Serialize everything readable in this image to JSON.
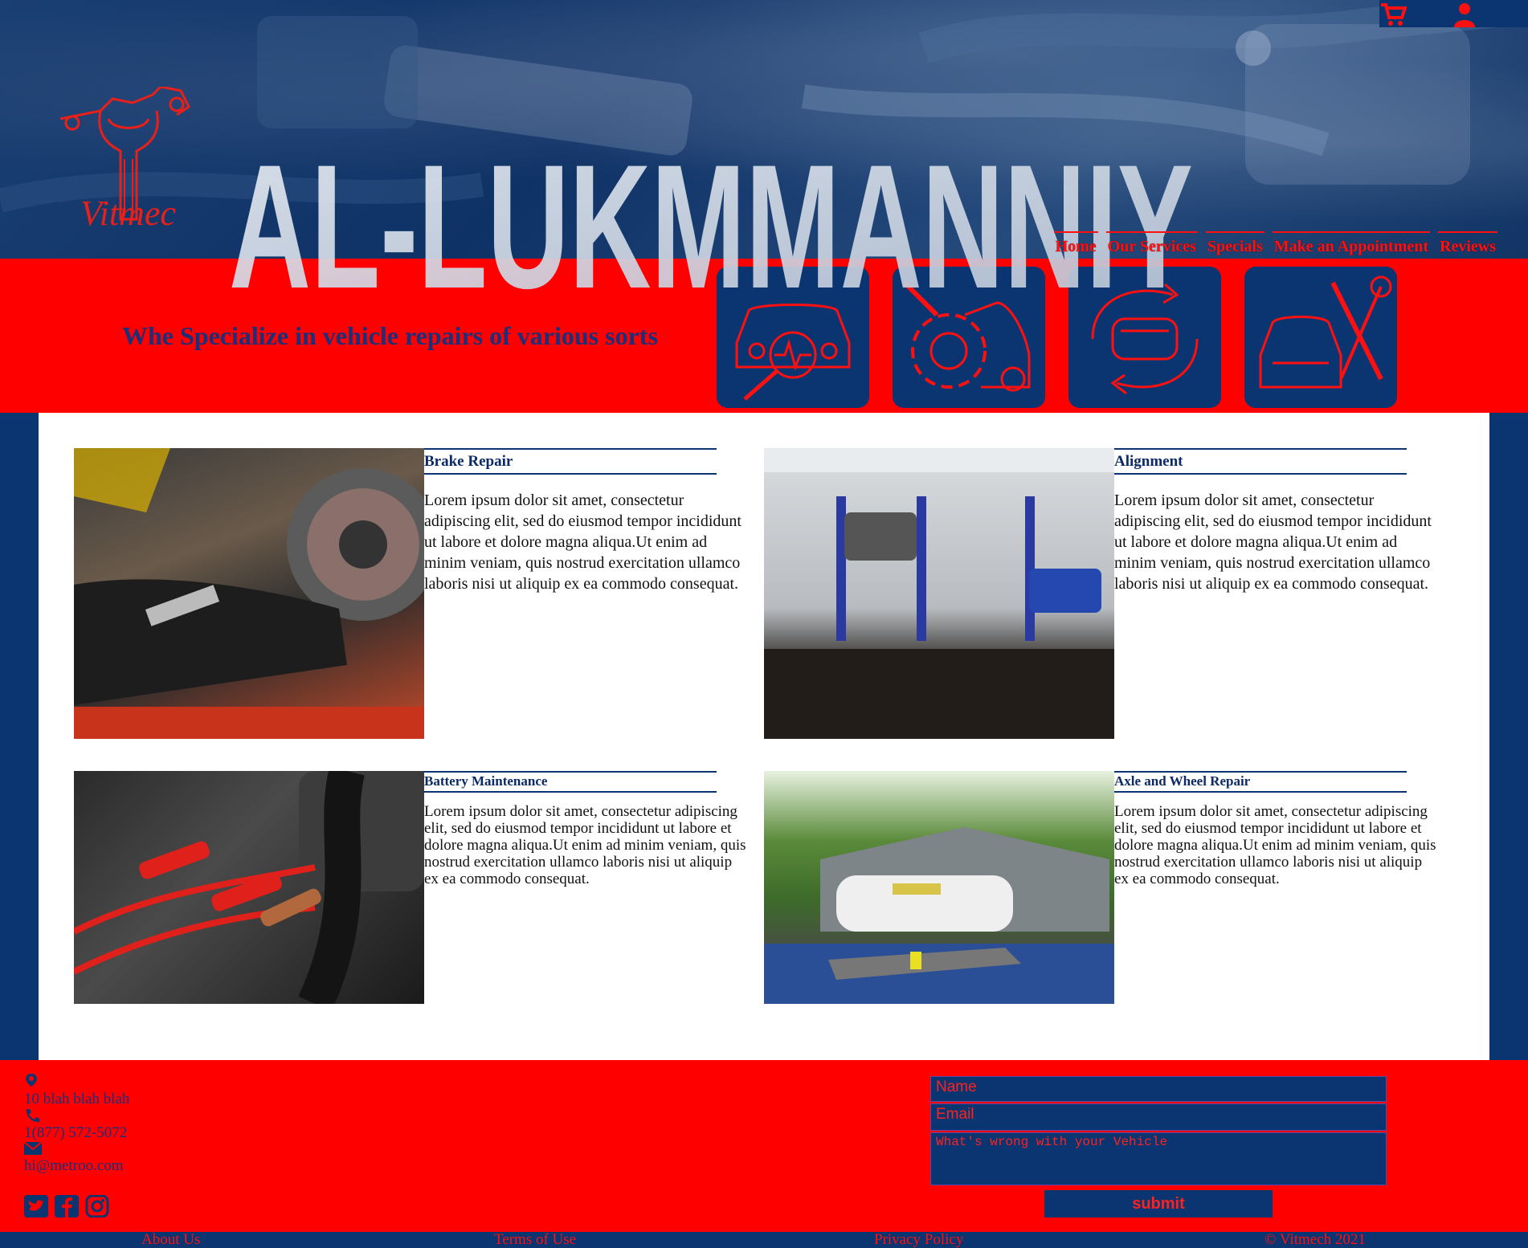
{
  "brand": {
    "logo_text": "Vitmec",
    "title": "AL-LUKMMANNIY",
    "tagline": "Whe Specialize in vehicle repairs of various sorts"
  },
  "header_icons": [
    "cart-icon",
    "user-icon"
  ],
  "nav": [
    "Home",
    "Our Services",
    "Specials",
    "Make an Appointment",
    "Reviews"
  ],
  "service_tiles": [
    "car-diagnostic-icon",
    "car-gear-service-icon",
    "car-rotation-icon",
    "car-tools-icon"
  ],
  "cards": [
    {
      "title": "Brake Repair",
      "body": "Lorem ipsum dolor sit amet, consectetur adipiscing elit, sed do eiusmod tempor incididunt ut labore et dolore magna aliqua.Ut enim ad minim veniam, quis nostrud exercitation ullamco laboris nisi ut aliquip ex ea commodo consequat."
    },
    {
      "title": "Alignment",
      "body": "Lorem ipsum dolor sit amet, consectetur adipiscing elit, sed do eiusmod tempor incididunt ut labore et dolore magna aliqua.Ut enim ad minim veniam, quis nostrud exercitation ullamco laboris nisi ut aliquip ex ea commodo consequat."
    },
    {
      "title": "Battery Maintenance",
      "body": "Lorem ipsum dolor sit amet, consectetur adipiscing elit, sed do eiusmod tempor incididunt ut labore et dolore magna aliqua.Ut enim ad minim veniam, quis nostrud exercitation ullamco laboris nisi ut aliquip ex ea commodo consequat."
    },
    {
      "title": "Axle and Wheel Repair",
      "body": "Lorem ipsum dolor sit amet, consectetur adipiscing elit, sed do eiusmod tempor incididunt ut labore et dolore magna aliqua.Ut enim ad minim veniam, quis nostrud exercitation ullamco laboris nisi ut aliquip ex ea commodo consequat."
    }
  ],
  "contact": {
    "address": "10 blah blah blah",
    "phone": "1(877) 572-5072",
    "email": "hi@metroo.com"
  },
  "social": [
    "twitter-icon",
    "facebook-icon",
    "instagram-icon"
  ],
  "form": {
    "name_placeholder": "Name",
    "email_placeholder": "Email",
    "message_placeholder": "What's wrong with your Vehicle",
    "submit_label": "submit"
  },
  "footer_links": [
    "About Us",
    "Terms of Use",
    "Privacy Policy",
    "© Vitmech 2021"
  ],
  "colors": {
    "navy": "#0b3570",
    "red": "#ff0000",
    "white": "#ffffff"
  }
}
